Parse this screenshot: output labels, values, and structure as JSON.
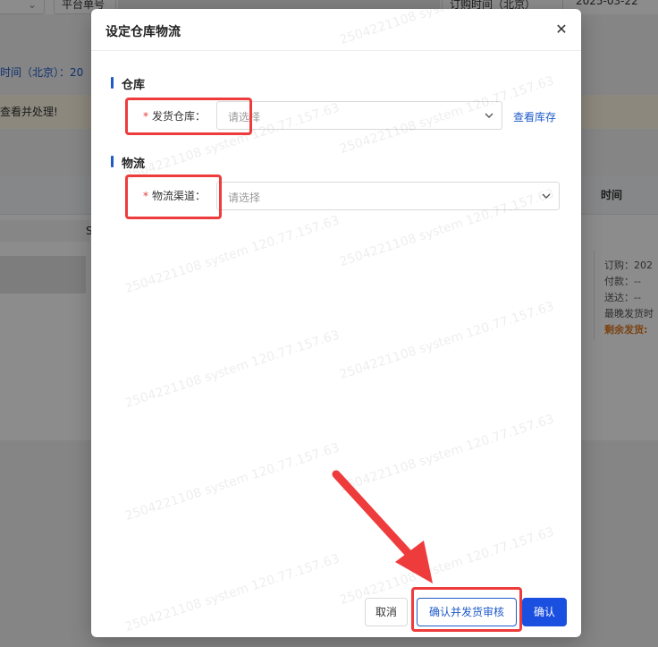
{
  "background": {
    "filter_select_platform": "平台单号",
    "filter_select_order_time": "订购时间（北京）",
    "filter_date": "2025-03-22",
    "info_text": "时间（北京）：20",
    "alert_text": "查看并处理!",
    "table_header_time": "时间",
    "row_marker": "S",
    "order_lines": [
      "订购：202",
      "付款：--",
      "送达：--",
      "最晚发货时"
    ],
    "order_warning": "剩余发货:"
  },
  "dialog": {
    "title": "设定仓库物流",
    "close_icon": "close-icon",
    "warehouse_section": {
      "title": "仓库",
      "field_label": "发货仓库：",
      "required_mark": "*",
      "placeholder": "请选择",
      "view_stock_link": "查看库存"
    },
    "logistics_section": {
      "title": "物流",
      "field_label": "物流渠道：",
      "required_mark": "*",
      "placeholder": "请选择"
    },
    "footer": {
      "cancel_label": "取消",
      "confirm_and_review_label": "确认并发货审核",
      "confirm_label": "确认"
    }
  },
  "watermark_text": "2504221108 system 120.77.157.63",
  "colors": {
    "accent": "#1f5ac9",
    "primary_button": "#1a4fe0",
    "required": "#e53935",
    "annotation_red": "#ee3b3b"
  }
}
